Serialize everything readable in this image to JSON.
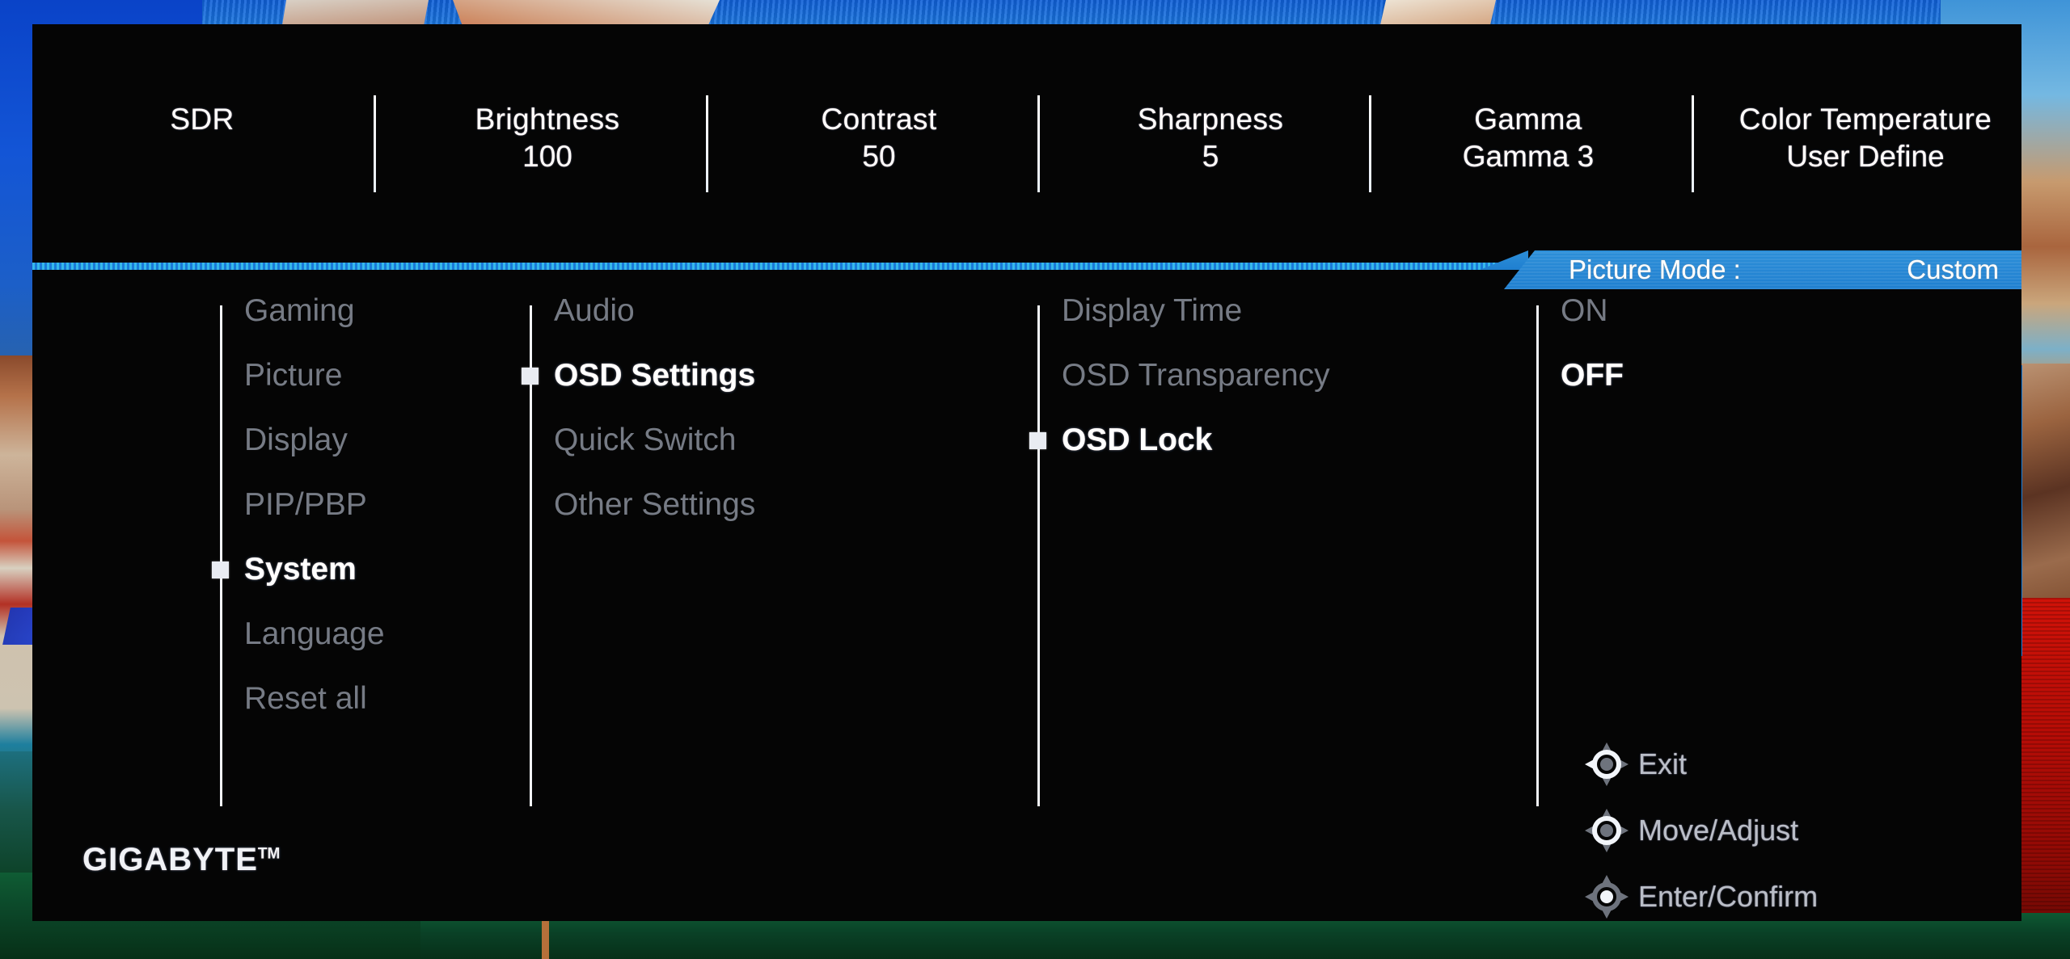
{
  "header": {
    "items": [
      {
        "label": "SDR",
        "value": ""
      },
      {
        "label": "Brightness",
        "value": "100"
      },
      {
        "label": "Contrast",
        "value": "50"
      },
      {
        "label": "Sharpness",
        "value": "5"
      },
      {
        "label": "Gamma",
        "value": "Gamma 3"
      },
      {
        "label": "Color Temperature",
        "value": "User Define"
      }
    ]
  },
  "picture_mode": {
    "label": "Picture Mode :",
    "value": "Custom"
  },
  "menu": {
    "column1": [
      {
        "label": "Gaming",
        "selected": false
      },
      {
        "label": "Picture",
        "selected": false
      },
      {
        "label": "Display",
        "selected": false
      },
      {
        "label": "PIP/PBP",
        "selected": false
      },
      {
        "label": "System",
        "selected": true
      },
      {
        "label": "Language",
        "selected": false
      },
      {
        "label": "Reset all",
        "selected": false
      }
    ],
    "column2": [
      {
        "label": "Audio",
        "selected": false
      },
      {
        "label": "OSD Settings",
        "selected": true
      },
      {
        "label": "Quick Switch",
        "selected": false
      },
      {
        "label": "Other Settings",
        "selected": false
      }
    ],
    "column3": [
      {
        "label": "Display Time",
        "selected": false
      },
      {
        "label": "OSD Transparency",
        "selected": false
      },
      {
        "label": "OSD Lock",
        "selected": true
      }
    ],
    "column4": [
      {
        "label": "ON",
        "selected": false
      },
      {
        "label": "OFF",
        "selected": true
      }
    ]
  },
  "nav_hints": [
    {
      "label": "Exit",
      "icon": "dpad-left-icon"
    },
    {
      "label": "Move/Adjust",
      "icon": "dpad-ring-icon"
    },
    {
      "label": "Enter/Confirm",
      "icon": "dpad-center-icon"
    }
  ],
  "brand": {
    "name": "GIGABYTE",
    "tm": "TM"
  },
  "colors": {
    "accent_blue": "#1f7fd0",
    "panel_bg": "#050505",
    "text_selected": "#ffffff",
    "text_dim": "#767b85"
  }
}
